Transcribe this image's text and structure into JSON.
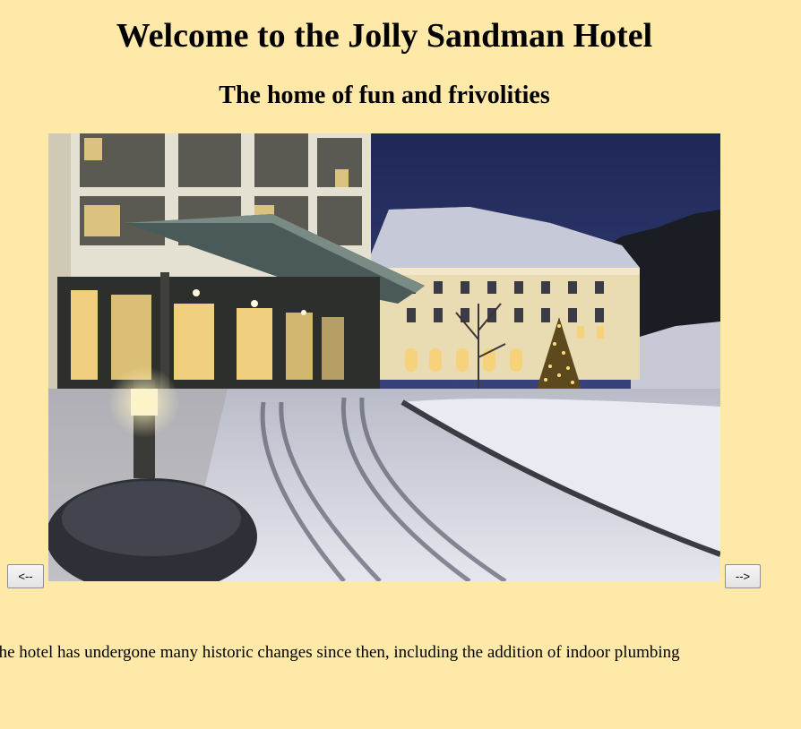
{
  "header": {
    "title": "Welcome to the Jolly Sandman Hotel",
    "subtitle": "The home of fun and frivolities"
  },
  "slideshow": {
    "image_subject": "hotel-exterior-winter-night",
    "prev_label": "<--",
    "next_label": "-->"
  },
  "history": {
    "text": "...Louise Sanderson. The hotel has undergone many historic changes since then, including the addition of indoor plumbing"
  },
  "colors": {
    "page_background": "#ffe9a8",
    "sky": "#2a3468",
    "snow": "#d8d8e0",
    "window_light": "#f6d27a"
  }
}
